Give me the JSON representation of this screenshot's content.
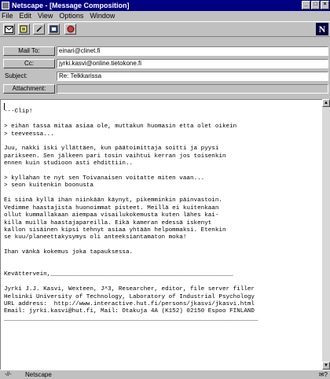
{
  "window": {
    "title": "Netscape - [Message Composition]"
  },
  "menu": [
    {
      "label": "File",
      "key": "F"
    },
    {
      "label": "Edit",
      "key": "E"
    },
    {
      "label": "View",
      "key": "V"
    },
    {
      "label": "Options",
      "key": "O"
    },
    {
      "label": "Window",
      "key": "W"
    }
  ],
  "toolbar": {
    "icons": [
      "send-icon",
      "quote-icon",
      "attach-icon",
      "address-book-icon",
      "stop-icon"
    ],
    "logo": "N"
  },
  "fields": {
    "mail_to_label": "Mail To:",
    "mail_to_value": "einari@clinet.fi",
    "cc_label": "Cc:",
    "cc_value": "jyrki.kasvi@online.tietokone.fi",
    "subject_label": "Subject:",
    "subject_value": "Re: Telkkarissa",
    "attachment_label": "Attachment:",
    "attachment_value": ""
  },
  "body": [
    "",
    "---Clip!",
    "",
    "> eihan tassa mitaa asiaa ole, muttakun huomasin etta olet oikein",
    "> teeveessa...",
    "",
    "Juu, nakki iski yllättäen, kun päätoimittaja soitti ja pyysi",
    "parikseen. Sen jälkeen pari tosin vaihtui kerran jos toisenkin",
    "ennen kuin studioon asti ehdittiin..",
    "",
    "> kyllahan te nyt sen Toivanaisen voitatte miten vaan...",
    "> seon kuitenkin boonusta",
    "",
    "Ei siinä kyllä ihan niinkään käynyt, pikemminkin päinvastoin.",
    "Vedimme haastajista huonoimmat pisteet. Meillä ei kuitenkaan",
    "ollut kummallakaan aiempaa visailukokemusta kuten lähes kai-",
    "killa muilla haastajapareilla. Eikä kameran edessä iskenyt",
    "kallon sisäinen kipsi tehnyt asiaa yhtään helpommaksi. Etenkin",
    "se kuu/planeettakysymys oli anteeksiantamaton moka!",
    "",
    "Ihan vänkä kokemus joka tapauksessa.",
    "",
    "",
    "Kevättervein,___________________________________________________",
    "",
    "Jyrki J.J. Kasvi, Wexteen, J^3, Researcher, editor, file server filler",
    "Helsinki University of Technology, Laboratory of Industrial Psychology",
    "URL address:  http://www.interactive.hut.fi/persons/jkasvi/jkasvi.html",
    "Email: jyrki.kasvi@hut.fi, Mail: Otakuja 4A (K152) 02150 Espoo FINLAND",
    "_______________________________________________________________________"
  ],
  "statusbar": {
    "key_text": "-//-",
    "text": "Netscape",
    "mail_indicator": "✉?"
  }
}
